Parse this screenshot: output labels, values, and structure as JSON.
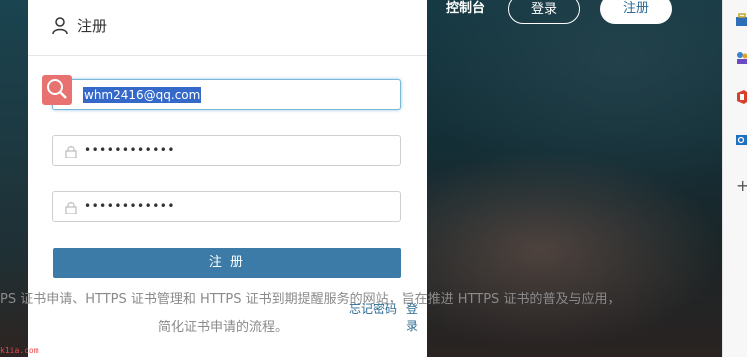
{
  "nav": {
    "console": "控制台",
    "login": "登录",
    "register": "注册"
  },
  "panel": {
    "title": "注册",
    "email_value": "whm2416@qq.com",
    "password_value": "••••••••••••",
    "confirm_password_value": "••••••••••••",
    "submit_label": "注 册",
    "forgot_link": "忘记密码",
    "login_link": "登录"
  },
  "description": {
    "line1": "PS 证书申请、HTTPS 证书管理和 HTTPS 证书到期提醒服务的网站，旨在推进 HTTPS 证书的普及与应用，",
    "line2": "简化证书申请的流程。"
  },
  "watermark": "k1ia.com",
  "colors": {
    "accent": "#3c7ba7",
    "link": "#2c6b93",
    "badge": "#e8726f"
  }
}
